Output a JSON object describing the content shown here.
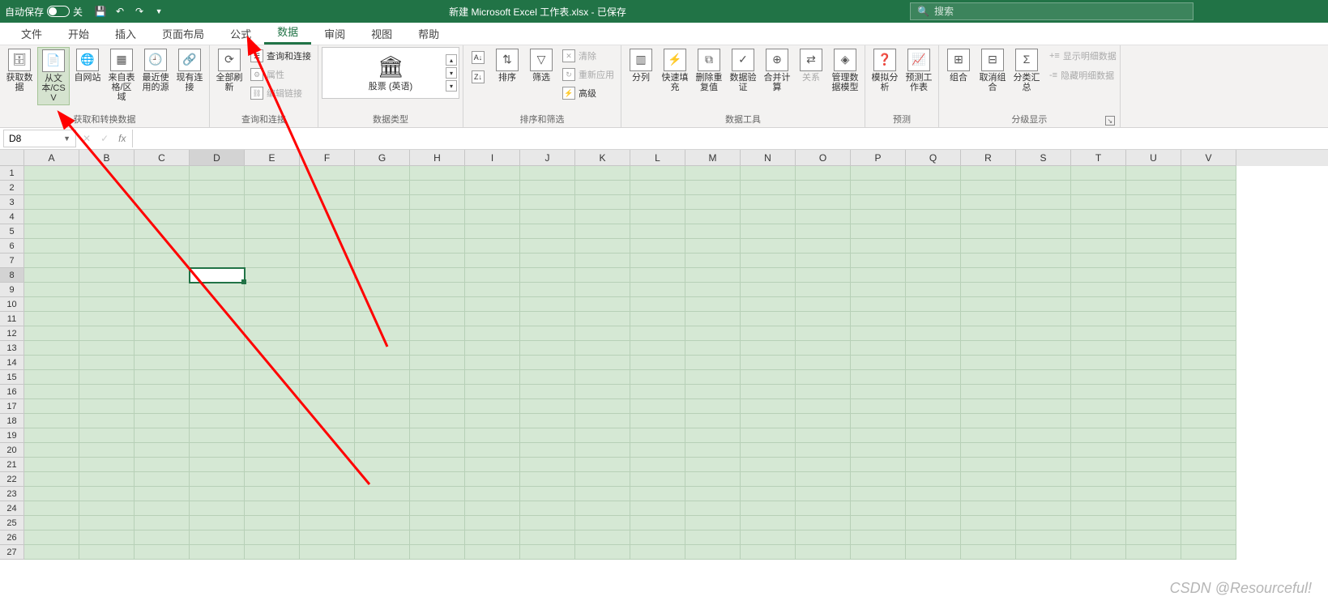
{
  "titlebar": {
    "autosave_label": "自动保存",
    "autosave_state": "关",
    "title": "新建 Microsoft Excel 工作表.xlsx - 已保存",
    "search_placeholder": "搜索"
  },
  "tabs": [
    "文件",
    "开始",
    "插入",
    "页面布局",
    "公式",
    "数据",
    "审阅",
    "视图",
    "帮助"
  ],
  "active_tab_index": 5,
  "ribbon": {
    "g1": {
      "label": "获取和转换数据",
      "btns": [
        "获取数据",
        "从文本/CSV",
        "自网站",
        "来自表格/区域",
        "最近使用的源",
        "现有连接"
      ]
    },
    "g2": {
      "label": "查询和连接",
      "refresh": "全部刷新",
      "opts": [
        "查询和连接",
        "属性",
        "编辑链接"
      ]
    },
    "g3": {
      "label": "数据类型",
      "stock": "股票 (英语)"
    },
    "g4": {
      "label": "排序和筛选",
      "sort": "排序",
      "filter": "筛选",
      "opts": [
        "清除",
        "重新应用",
        "高级"
      ]
    },
    "g5": {
      "label": "数据工具",
      "btns": [
        "分列",
        "快速填充",
        "删除重复值",
        "数据验证",
        "合并计算",
        "关系",
        "管理数据模型"
      ]
    },
    "g6": {
      "label": "预测",
      "btns": [
        "模拟分析",
        "预测工作表"
      ]
    },
    "g7": {
      "label": "分级显示",
      "btns": [
        "组合",
        "取消组合",
        "分类汇总"
      ],
      "opts": [
        "显示明细数据",
        "隐藏明细数据"
      ]
    }
  },
  "formula": {
    "name_box": "D8",
    "fx_value": ""
  },
  "columns": [
    "A",
    "B",
    "C",
    "D",
    "E",
    "F",
    "G",
    "H",
    "I",
    "J",
    "K",
    "L",
    "M",
    "N",
    "O",
    "P",
    "Q",
    "R",
    "S",
    "T",
    "U",
    "V"
  ],
  "row_count": 27,
  "selected": {
    "col": 3,
    "row": 7
  },
  "watermark": "CSDN @Resourceful!"
}
